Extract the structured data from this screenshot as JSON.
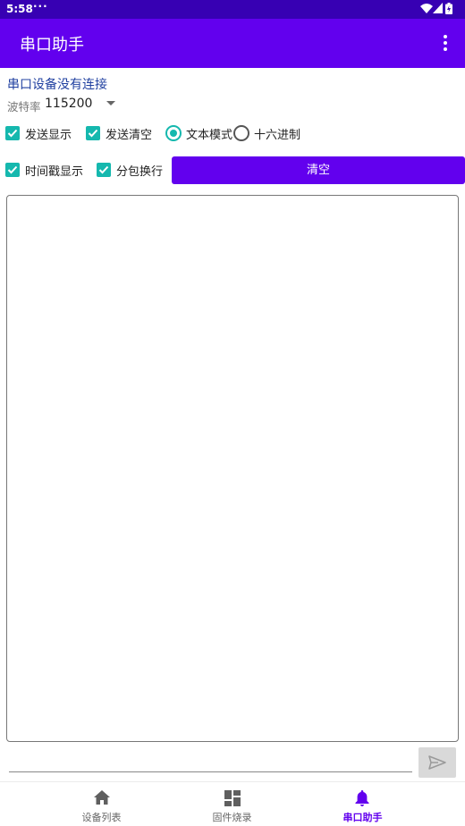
{
  "status_bar": {
    "time": "5:58",
    "notification_dots": "···",
    "icons": [
      "wifi-icon",
      "cell-signal-icon",
      "battery-icon"
    ]
  },
  "app_bar": {
    "title": "串口助手",
    "menu_icon": "overflow-menu-icon"
  },
  "serial": {
    "connection_status": "串口设备没有连接",
    "baud_label": "波特率",
    "baud_value": "115200"
  },
  "options": {
    "send_display": {
      "label": "发送显示",
      "checked": true
    },
    "send_clear": {
      "label": "发送清空",
      "checked": true
    },
    "text_mode": {
      "label": "文本模式",
      "selected": true
    },
    "hex_mode": {
      "label": "十六进制",
      "selected": false
    },
    "timestamp_display": {
      "label": "时间戳显示",
      "checked": true
    },
    "packet_newline": {
      "label": "分包换行",
      "checked": true
    }
  },
  "clear_button": {
    "label": "清空"
  },
  "send": {
    "input_value": "",
    "button_icon": "send-icon"
  },
  "bottom_nav": {
    "items": [
      {
        "label": "设备列表",
        "icon": "home-icon",
        "active": false
      },
      {
        "label": "固件烧录",
        "icon": "dashboard-icon",
        "active": false
      },
      {
        "label": "串口助手",
        "icon": "bell-icon",
        "active": true
      }
    ]
  },
  "colors": {
    "status_bar": "#3700b3",
    "primary": "#6200ee",
    "accent": "#15b8ae",
    "link_text": "#2040a0"
  }
}
